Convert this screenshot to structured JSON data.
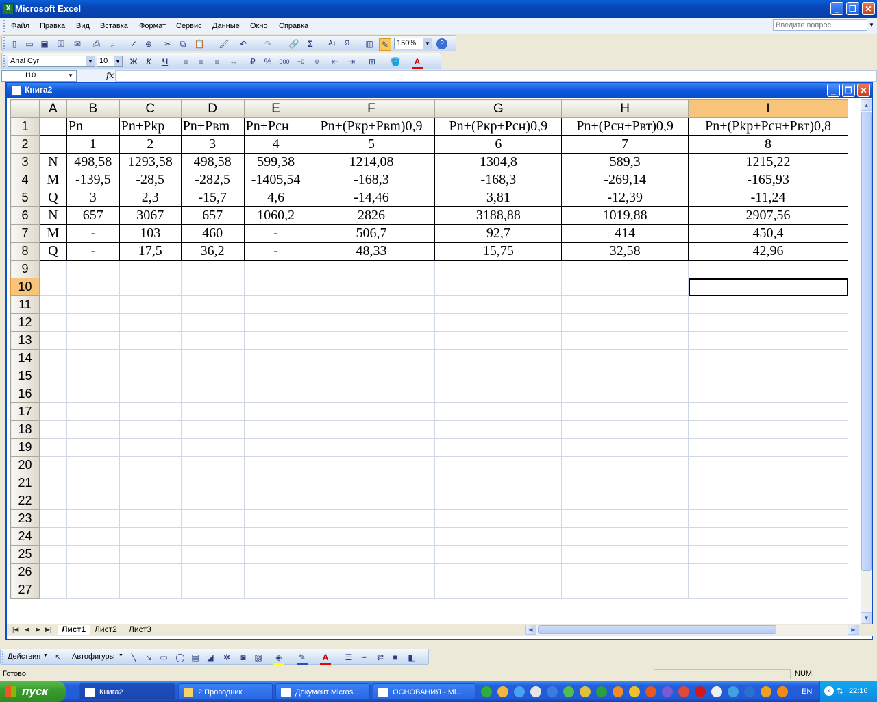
{
  "app": {
    "title": "Microsoft Excel",
    "icon_label": "X"
  },
  "window_buttons": {
    "minimize": "_",
    "restore": "❐",
    "close": "✕"
  },
  "menu": [
    "Файл",
    "Правка",
    "Вид",
    "Вставка",
    "Формат",
    "Сервис",
    "Данные",
    "Окно",
    "Справка"
  ],
  "ask_placeholder": "Введите вопрос",
  "toolbar": {
    "zoom": "150%",
    "font": "Arial Cyr",
    "size": "10",
    "bold": "Ж",
    "italic": "К",
    "underline": "Ч",
    "sum": "Σ",
    "percent": "%",
    "thousands": "000",
    "help": "?"
  },
  "formula_bar": {
    "name_box": "I10",
    "fx": "fx",
    "value": ""
  },
  "workbook": {
    "title": "Книга2"
  },
  "sheet": {
    "columns": [
      "A",
      "B",
      "C",
      "D",
      "E",
      "F",
      "G",
      "H",
      "I"
    ],
    "selected_column": "I",
    "selected_row": "10",
    "active_cell": "I10",
    "rows": [
      {
        "n": "1",
        "cells": [
          "",
          "Pn",
          "Pn+Pkp",
          "Pn+Pвm",
          "Pn+Pсн",
          "Pn+(Pкр+Pвm)0,9",
          "Pn+(Pкр+Pсн)0,9",
          "Pn+(Pсн+Pвт)0,9",
          "Pn+(Pkp+Pсн+Pвт)0,8"
        ]
      },
      {
        "n": "2",
        "cells": [
          "",
          "1",
          "2",
          "3",
          "4",
          "5",
          "6",
          "7",
          "8"
        ]
      },
      {
        "n": "3",
        "cells": [
          "N",
          "498,58",
          "1293,58",
          "498,58",
          "599,38",
          "1214,08",
          "1304,8",
          "589,3",
          "1215,22"
        ]
      },
      {
        "n": "4",
        "cells": [
          "M",
          "-139,5",
          "-28,5",
          "-282,5",
          "-1405,54",
          "-168,3",
          "-168,3",
          "-269,14",
          "-165,93"
        ]
      },
      {
        "n": "5",
        "cells": [
          "Q",
          "3",
          "2,3",
          "-15,7",
          "4,6",
          "-14,46",
          "3,81",
          "-12,39",
          "-11,24"
        ]
      },
      {
        "n": "6",
        "cells": [
          "N",
          "657",
          "3067",
          "657",
          "1060,2",
          "2826",
          "3188,88",
          "1019,88",
          "2907,56"
        ]
      },
      {
        "n": "7",
        "cells": [
          "M",
          "-",
          "103",
          "460",
          "-",
          "506,7",
          "92,7",
          "414",
          "450,4"
        ]
      },
      {
        "n": "8",
        "cells": [
          "Q",
          "-",
          "17,5",
          "36,2",
          "-",
          "48,33",
          "15,75",
          "32,58",
          "42,96"
        ]
      }
    ],
    "empty_rows": [
      "9",
      "10",
      "11",
      "12",
      "13",
      "14",
      "15",
      "16",
      "17",
      "18",
      "19",
      "20",
      "21",
      "22",
      "23",
      "24",
      "25",
      "26",
      "27"
    ]
  },
  "sheet_tabs": [
    "Лист1",
    "Лист2",
    "Лист3"
  ],
  "active_tab": "Лист1",
  "draw_toolbar": {
    "actions": "Действия",
    "autoshapes": "Автофигуры"
  },
  "status": {
    "left": "Готово",
    "num": "NUM"
  },
  "taskbar": {
    "start": "пуск",
    "tasks": [
      "Книга2",
      "2 Проводник",
      "Документ Micros...",
      "ОСНОВАНИЯ - Mi..."
    ],
    "lang": "EN",
    "clock": "22:16"
  },
  "colors": {
    "title_blue": "#0a5fd6",
    "selected_header": "#f7c579",
    "start_green": "#3a9d2e"
  }
}
